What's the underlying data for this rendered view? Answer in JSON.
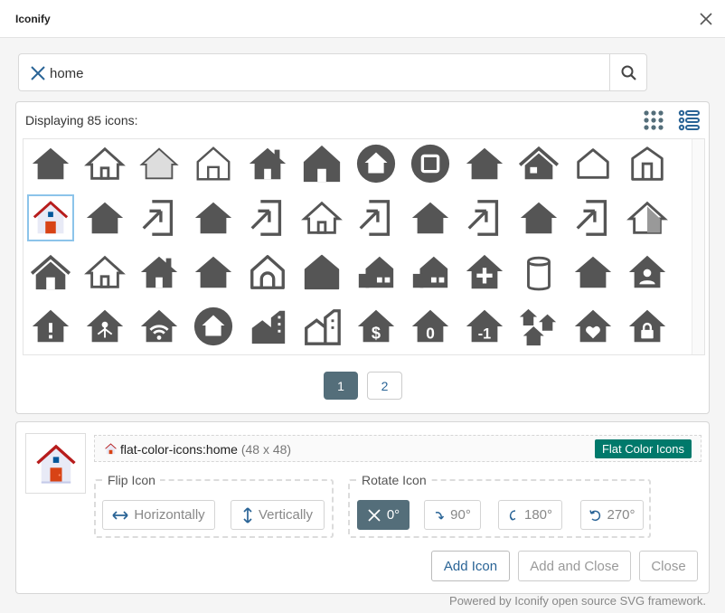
{
  "window": {
    "title": "Iconify"
  },
  "search": {
    "value": "home",
    "placeholder": ""
  },
  "results": {
    "count_text": "Displaying 85 icons:",
    "icons": [
      "home-solid-icon",
      "home-outline-icon",
      "home-gray-outline-icon",
      "home-outline-thin-icon",
      "home-chimney-icon",
      "home-tall-icon",
      "home-circle-icon",
      "home-circle-square-icon",
      "home-solid-icon",
      "home-roof-icon",
      "home-rounded-outline-icon",
      "home-outline-door-icon",
      "home-flat-color-icon",
      "home-solid-icon",
      "home-import-icon",
      "home-solid-icon",
      "home-import-icon",
      "home-outline-icon",
      "home-import-icon",
      "home-solid-icon",
      "home-import-icon",
      "home-solid-icon",
      "home-import-icon",
      "home-half-icon",
      "home-large-icon",
      "home-outline-icon",
      "home-chimney-icon",
      "home-solid-icon",
      "home-arch-outline-icon",
      "home-arch-icon",
      "home-city-icon",
      "home-city-icon",
      "home-plus-icon",
      "smart-speaker-icon",
      "home-solid-icon",
      "home-account-icon",
      "home-alert-icon",
      "home-automation-icon",
      "home-wifi-icon",
      "home-circle-icon",
      "home-buildings-icon",
      "home-buildings-outline-icon",
      "home-currency-usd-icon",
      "home-floor-0-icon",
      "home-floor-negative-1-icon",
      "home-group-icon",
      "home-heart-icon",
      "home-lock-icon"
    ]
  },
  "pagination": {
    "pages": [
      "1",
      "2"
    ],
    "current": "1"
  },
  "selected": {
    "name": "flat-color-icons:home",
    "size": "(48 x 48)",
    "collection": "Flat Color Icons"
  },
  "flip": {
    "legend": "Flip Icon",
    "horizontal": "Horizontally",
    "vertical": "Vertically"
  },
  "rotate": {
    "legend": "Rotate Icon",
    "options": [
      "0°",
      "90°",
      "180°",
      "270°"
    ],
    "active": "0°"
  },
  "actions": {
    "add": "Add Icon",
    "add_close": "Add and Close",
    "close": "Close"
  },
  "footer": {
    "powered": "Powered by Iconify open source SVG framework."
  },
  "colors": {
    "accent": "#546e7a",
    "collection_badge": "#00796b",
    "link": "#2a6496",
    "icon": "#555555"
  }
}
